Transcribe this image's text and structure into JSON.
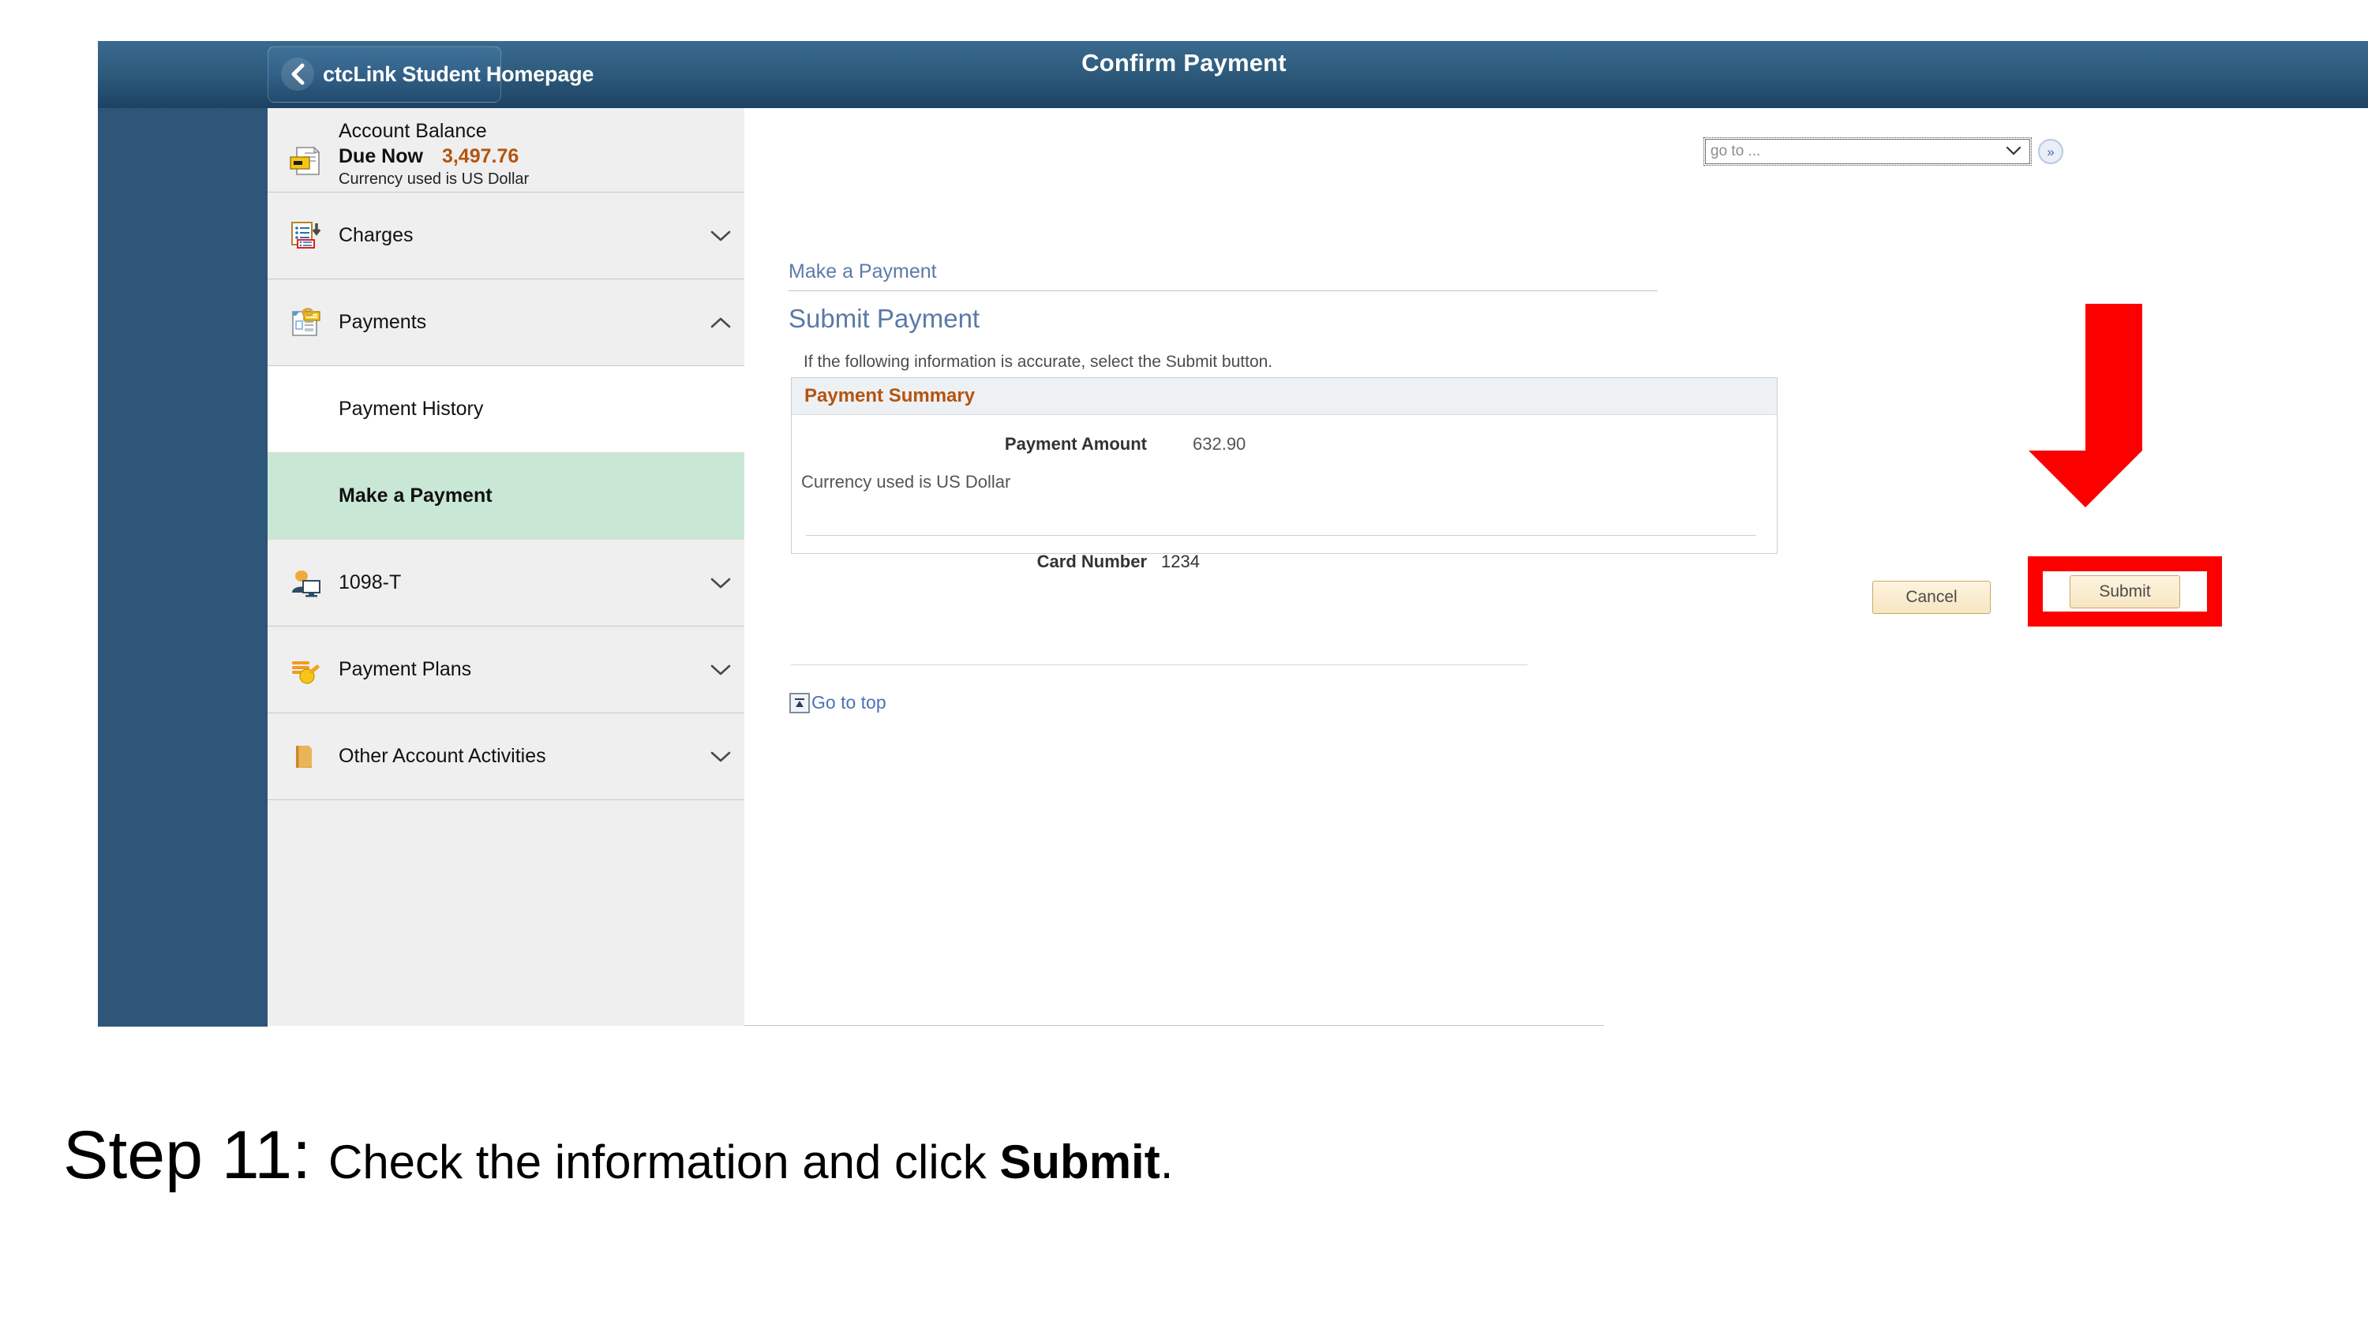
{
  "header": {
    "back_button_label": "ctcLink Student Homepage",
    "back_icon": "chevron-left-icon",
    "page_title": "Confirm Payment",
    "gradient_from": "#396a8e",
    "gradient_to": "#1d4263"
  },
  "goto": {
    "placeholder": "go to ...",
    "selected": "go to ...",
    "options": [
      "go to ..."
    ],
    "button_glyph": "»",
    "button_name": "go-to-forward-button"
  },
  "sidebar": {
    "balance": {
      "title": "Account Balance",
      "due_label": "Due Now",
      "due_amount": "3,497.76",
      "amount_color": "#b4540f",
      "currency_note": "Currency used is US Dollar",
      "icon": "account-balance-document-icon"
    },
    "items": [
      {
        "label": "Charges",
        "icon": "charges-list-icon",
        "chevron": "chevron-down-icon",
        "expanded": false
      },
      {
        "label": "Payments",
        "icon": "payments-document-icon",
        "chevron": "chevron-up-icon",
        "expanded": true
      },
      {
        "label": "1098-T",
        "icon": "person-monitor-icon",
        "chevron": "chevron-down-icon",
        "expanded": false
      },
      {
        "label": "Payment Plans",
        "icon": "coins-icon",
        "chevron": "chevron-down-icon",
        "expanded": false
      },
      {
        "label": "Other Account Activities",
        "icon": "folder-icon",
        "chevron": "chevron-down-icon",
        "expanded": false
      }
    ],
    "subitems": [
      {
        "label": "Payment History",
        "active": false
      },
      {
        "label": "Make a Payment",
        "active": true,
        "active_bg": "#c9e7d5"
      }
    ]
  },
  "main": {
    "breadcrumb": "Make a Payment",
    "section_title": "Submit Payment",
    "helper_text": "If the following information is accurate, select the Submit button.",
    "summary": {
      "header": "Payment Summary",
      "header_color": "#b4540f",
      "payment_amount_label": "Payment Amount",
      "payment_amount_value": "632.90",
      "currency_note": "Currency used is US Dollar",
      "card_number_label": "Card Number",
      "card_number_value": "1234"
    },
    "buttons": {
      "cancel": "Cancel",
      "submit": "Submit"
    },
    "go_to_top": {
      "label": "Go to top",
      "icon": "go-to-top-icon"
    }
  },
  "annotations": {
    "highlight_color": "#fc0000",
    "arrow": "down-arrow-annotation",
    "highlight_box_target": "Submit"
  },
  "caption": {
    "step": "Step 11:",
    "text": "Check the information and click ",
    "emphasis": "Submit",
    "period": "."
  }
}
